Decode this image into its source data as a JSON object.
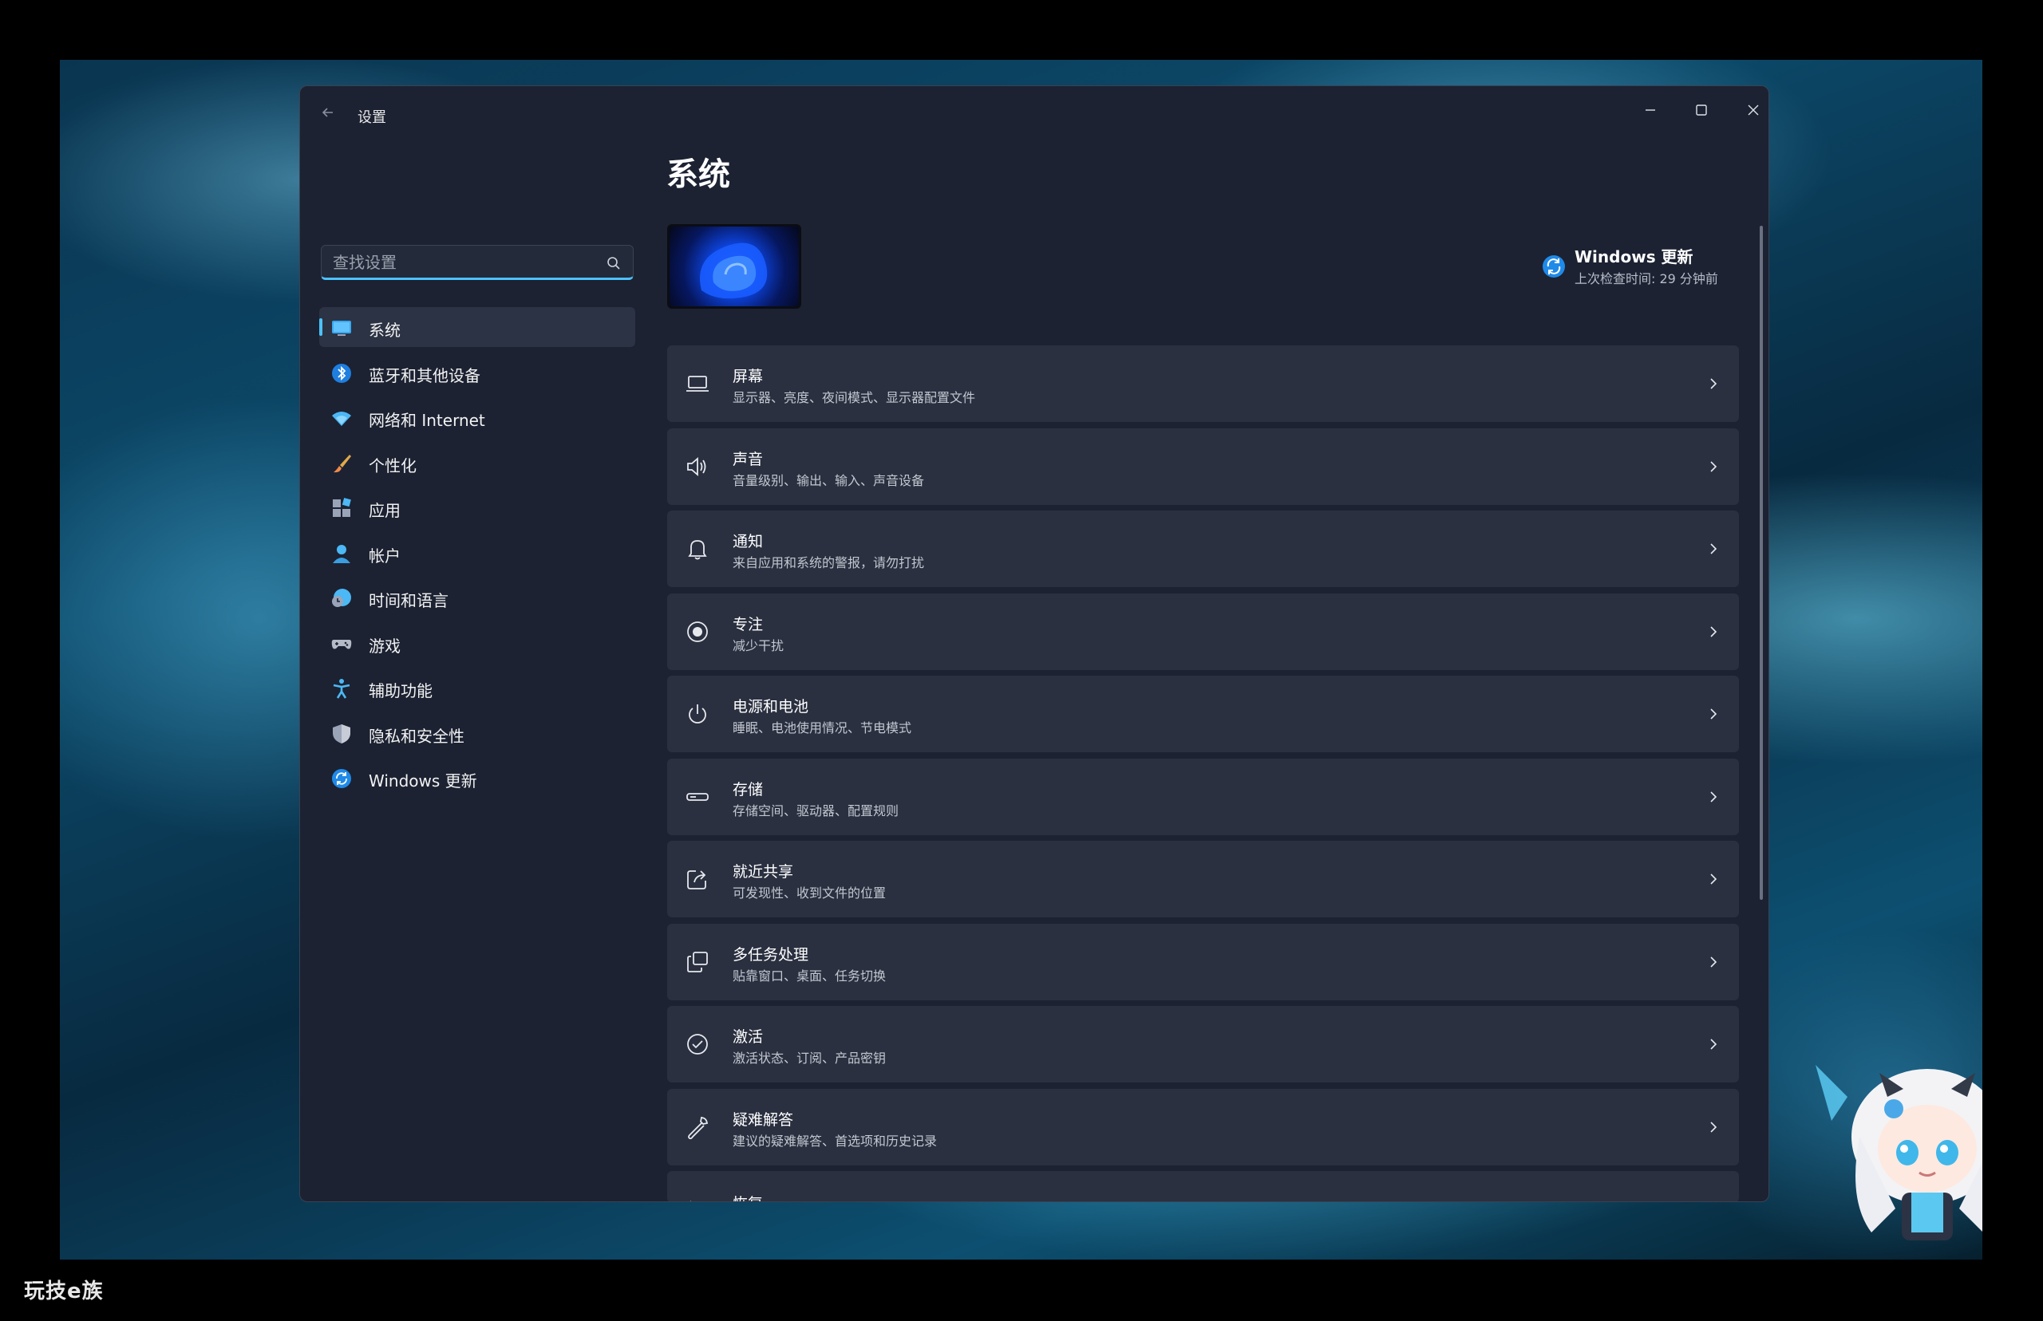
{
  "window": {
    "title": "设置",
    "back_icon": "arrow-left-icon",
    "controls": [
      "minimize-icon",
      "maximize-icon",
      "close-icon"
    ]
  },
  "search": {
    "placeholder": "查找设置",
    "value": ""
  },
  "nav": {
    "items": [
      {
        "label": "系统",
        "icon": "monitor-icon",
        "active": true
      },
      {
        "label": "蓝牙和其他设备",
        "icon": "bluetooth-icon"
      },
      {
        "label": "网络和 Internet",
        "icon": "wifi-icon"
      },
      {
        "label": "个性化",
        "icon": "paintbrush-icon"
      },
      {
        "label": "应用",
        "icon": "apps-icon"
      },
      {
        "label": "帐户",
        "icon": "person-icon"
      },
      {
        "label": "时间和语言",
        "icon": "globe-clock-icon"
      },
      {
        "label": "游戏",
        "icon": "gamepad-icon"
      },
      {
        "label": "辅助功能",
        "icon": "accessibility-icon"
      },
      {
        "label": "隐私和安全性",
        "icon": "shield-icon"
      },
      {
        "label": "Windows 更新",
        "icon": "sync-icon"
      }
    ]
  },
  "main": {
    "title": "系统",
    "update": {
      "title": "Windows 更新",
      "subtitle": "上次检查时间: 29 分钟前"
    },
    "rows": [
      {
        "title": "屏幕",
        "subtitle": "显示器、亮度、夜间模式、显示器配置文件",
        "icon": "laptop-icon"
      },
      {
        "title": "声音",
        "subtitle": "音量级别、输出、输入、声音设备",
        "icon": "speaker-icon"
      },
      {
        "title": "通知",
        "subtitle": "来自应用和系统的警报，请勿打扰",
        "icon": "bell-icon"
      },
      {
        "title": "专注",
        "subtitle": "减少干扰",
        "icon": "focus-icon"
      },
      {
        "title": "电源和电池",
        "subtitle": "睡眠、电池使用情况、节电模式",
        "icon": "power-icon"
      },
      {
        "title": "存储",
        "subtitle": "存储空间、驱动器、配置规则",
        "icon": "storage-icon"
      },
      {
        "title": "就近共享",
        "subtitle": "可发现性、收到文件的位置",
        "icon": "share-icon"
      },
      {
        "title": "多任务处理",
        "subtitle": "贴靠窗口、桌面、任务切换",
        "icon": "multitask-icon"
      },
      {
        "title": "激活",
        "subtitle": "激活状态、订阅、产品密钥",
        "icon": "check-circle-icon"
      },
      {
        "title": "疑难解答",
        "subtitle": "建议的疑难解答、首选项和历史记录",
        "icon": "wrench-icon"
      },
      {
        "title": "恢复",
        "subtitle": "",
        "icon": "recovery-icon"
      }
    ]
  },
  "watermark": "玩技e族",
  "colors": {
    "accent": "#4cc2ff",
    "window_bg": "#1c2232",
    "card_bg": "#2a3040"
  }
}
